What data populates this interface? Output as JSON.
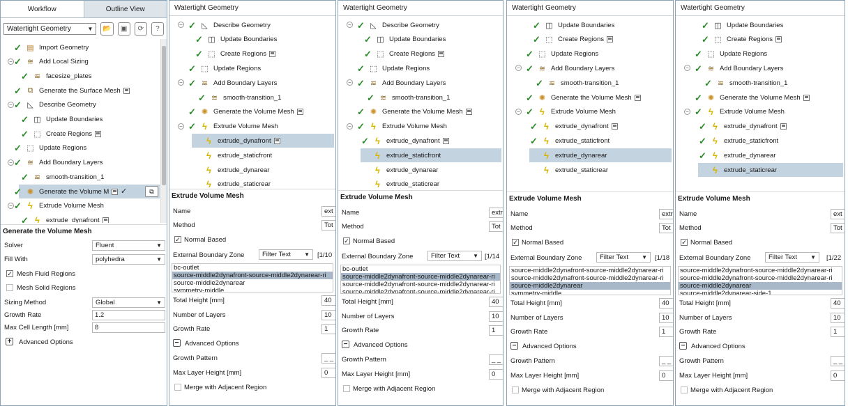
{
  "panel1": {
    "tab_workflow": "Workflow",
    "tab_outline": "Outline View",
    "workflow_select": "Watertight Geometry",
    "tree": [
      {
        "label": "Import Geometry",
        "icon": "import-icon",
        "save": false
      },
      {
        "label": "Add Local Sizing",
        "icon": "layers-icon",
        "save": false
      },
      {
        "label": "facesize_plates",
        "icon": "layers-icon",
        "save": false
      },
      {
        "label": "Generate the Surface Mesh",
        "icon": "surface-mesh-icon",
        "save": true
      },
      {
        "label": "Describe Geometry",
        "icon": "triangle-ruler-icon",
        "save": false
      },
      {
        "label": "Update Boundaries",
        "icon": "boundary-icon",
        "save": false
      },
      {
        "label": "Create Regions",
        "icon": "regions-icon",
        "save": true
      },
      {
        "label": "Update Regions",
        "icon": "update-regions-icon",
        "save": false
      },
      {
        "label": "Add Boundary Layers",
        "icon": "layers-icon",
        "save": false
      },
      {
        "label": "smooth-transition_1",
        "icon": "layers-icon",
        "save": false
      },
      {
        "label": "Generate the Volume M",
        "icon": "gear-icon",
        "save": true
      },
      {
        "label": "Extrude Volume Mesh",
        "icon": "extrude-icon",
        "save": false
      },
      {
        "label": "extrude_dynafront",
        "icon": "extrude-icon",
        "save": true
      }
    ],
    "section_title": "Generate the Volume Mesh",
    "solver_label": "Solver",
    "solver_value": "Fluent",
    "fill_label": "Fill With",
    "fill_value": "polyhedra",
    "mesh_fluid": "Mesh Fluid Regions",
    "mesh_solid": "Mesh Solid Regions",
    "sizing_label": "Sizing Method",
    "sizing_value": "Global",
    "growth_label": "Growth Rate",
    "growth_value": "1.2",
    "maxcell_label": "Max Cell Length [mm]",
    "maxcell_value": "8",
    "advanced": "Advanced Options"
  },
  "panel_common": {
    "title": "Watertight Geometry",
    "section_title": "Extrude Volume Mesh",
    "name_label": "Name",
    "method_label": "Method",
    "method_value": "Tot",
    "normal_based": "Normal Based",
    "ext_zone_label": "External Boundary Zone",
    "filter_text": "Filter Text",
    "total_height_label": "Total Height [mm]",
    "total_height_value": "40",
    "layers_label": "Number of Layers",
    "layers_value": "10",
    "growth_label": "Growth Rate",
    "growth_value": "1",
    "advanced": "Advanced Options",
    "growth_pattern_label": "Growth Pattern",
    "growth_pattern_value": "_ _",
    "max_layer_label": "Max Layer Height [mm]",
    "max_layer_value": "0",
    "merge_label": "Merge with Adjacent Region"
  },
  "panel2": {
    "tree": [
      "Describe Geometry",
      "Update Boundaries",
      "Create Regions",
      "Update Regions",
      "Add Boundary Layers",
      "smooth-transition_1",
      "Generate the Volume Mesh",
      "Extrude Volume Mesh",
      "extrude_dynafront",
      "extrude_staticfront",
      "extrude_dynarear",
      "extrude_staticrear"
    ],
    "name_value": "ext",
    "count": "[1/10",
    "list": [
      "bc-outlet",
      "source-middle2dynafront-source-middle2dynarear-ri",
      "source-middle2dynarear",
      "symmetry-middle"
    ]
  },
  "panel3": {
    "tree": [
      "Describe Geometry",
      "Update Boundaries",
      "Create Regions",
      "Update Regions",
      "Add Boundary Layers",
      "smooth-transition_1",
      "Generate the Volume Mesh",
      "Extrude Volume Mesh",
      "extrude_dynafront",
      "extrude_staticfront",
      "extrude_dynarear",
      "extrude_staticrear"
    ],
    "name_value": "extr",
    "count": "[1/14",
    "list": [
      "bc-outlet",
      "source-middle2dynafront-source-middle2dynarear-ri",
      "source-middle2dynafront-source-middle2dynarear-ri",
      "source-middle2dynafront-source-middle2dynarear-ri"
    ]
  },
  "panel4": {
    "tree": [
      "Update Boundaries",
      "Create Regions",
      "Update Regions",
      "Add Boundary Layers",
      "smooth-transition_1",
      "Generate the Volume Mesh",
      "Extrude Volume Mesh",
      "extrude_dynafront",
      "extrude_staticfront",
      "extrude_dynarear",
      "extrude_staticrear"
    ],
    "name_value": "extr",
    "count": "[1/18",
    "list": [
      "source-middle2dynafront-source-middle2dynarear-ri",
      "source-middle2dynafront-source-middle2dynarear-ri",
      "source-middle2dynarear",
      "symmetry-middle"
    ]
  },
  "panel5": {
    "tree": [
      "Update Boundaries",
      "Create Regions",
      "Update Regions",
      "Add Boundary Layers",
      "smooth-transition_1",
      "Generate the Volume Mesh",
      "Extrude Volume Mesh",
      "extrude_dynafront",
      "extrude_staticfront",
      "extrude_dynarear",
      "extrude_staticrear"
    ],
    "name_value": "ext",
    "count": "[1/22",
    "list": [
      "source-middle2dynafront-source-middle2dynarear-ri",
      "source-middle2dynafront-source-middle2dynarear-ri",
      "source-middle2dynarear",
      "source-middle2dynarear-side-1"
    ]
  }
}
